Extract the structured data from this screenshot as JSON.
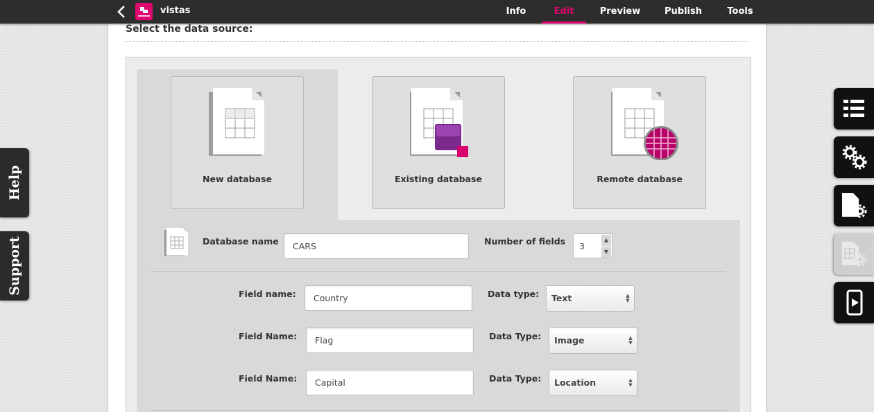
{
  "header": {
    "app_title": "vistas",
    "tabs": [
      {
        "label": "Info"
      },
      {
        "label": "Edit"
      },
      {
        "label": "Preview"
      },
      {
        "label": "Publish"
      },
      {
        "label": "Tools"
      }
    ],
    "active_tab": "Edit",
    "accent_color": "#e0066f"
  },
  "side_left": {
    "help_label": "Help",
    "support_label": "Support"
  },
  "main": {
    "section_title": "Select the data source:",
    "sources": [
      {
        "label": "New database",
        "icon": "new-database-icon"
      },
      {
        "label": "Existing database",
        "icon": "existing-database-icon"
      },
      {
        "label": "Remote database",
        "icon": "remote-database-icon"
      }
    ],
    "selected_source": "New database",
    "database_name_label": "Database name",
    "database_name_value": "CARS",
    "number_of_fields_label": "Number of fields",
    "number_of_fields_value": "3",
    "fields": [
      {
        "name_label": "Field name:",
        "name_value": "Country",
        "type_label": "Data type:",
        "type_value": "Text"
      },
      {
        "name_label": "Field Name:",
        "name_value": "Flag",
        "type_label": "Data Type:",
        "type_value": "Image"
      },
      {
        "name_label": "Field Name:",
        "name_value": "Capital",
        "type_label": "Data Type:",
        "type_value": "Location"
      }
    ]
  },
  "tools_right": [
    {
      "icon": "list-icon",
      "enabled": true
    },
    {
      "icon": "settings-gears-icon",
      "enabled": true
    },
    {
      "icon": "page-settings-icon",
      "enabled": true
    },
    {
      "icon": "table-settings-icon",
      "enabled": false
    },
    {
      "icon": "mobile-preview-icon",
      "enabled": true
    }
  ]
}
